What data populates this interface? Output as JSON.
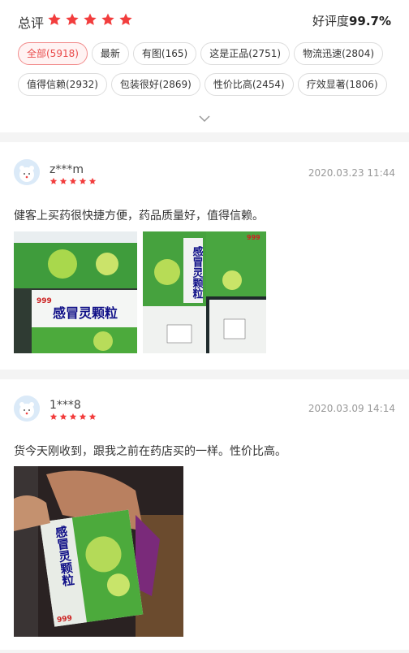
{
  "summary": {
    "title": "总评",
    "rating_label": "好评度",
    "rating_value": "99.7%"
  },
  "tags": [
    {
      "label": "全部(5918)",
      "active": true
    },
    {
      "label": "最新",
      "active": false
    },
    {
      "label": "有图(165)",
      "active": false
    },
    {
      "label": "这是正品(2751)",
      "active": false
    },
    {
      "label": "物流迅速(2804)",
      "active": false
    },
    {
      "label": "值得信赖(2932)",
      "active": false
    },
    {
      "label": "包装很好(2869)",
      "active": false
    },
    {
      "label": "性价比高(2454)",
      "active": false
    },
    {
      "label": "疗效显著(1806)",
      "active": false
    }
  ],
  "reviews": [
    {
      "user": "z***m",
      "stars": 5,
      "date": "2020.03.23 11:44",
      "content": "健客上买药很快捷方便，药品质量好，值得信赖。",
      "photos": [
        {
          "product": "感冒灵颗粒",
          "brand": "999"
        },
        {
          "product": "感冒灵颗粒",
          "brand": "999"
        }
      ]
    },
    {
      "user": "1***8",
      "stars": 5,
      "date": "2020.03.09 14:14",
      "content": "货今天刚收到，跟我之前在药店买的一样。性价比高。",
      "photos": [
        {
          "product": "感冒灵颗粒",
          "brand": "999"
        }
      ]
    }
  ],
  "colors": {
    "accent": "#e94b4b",
    "star": "#f23d3d",
    "divider": "#f4f4f4",
    "box_green": "#4caa3c"
  },
  "icons": {
    "star": "star-icon",
    "expand": "chevron-down-icon"
  }
}
